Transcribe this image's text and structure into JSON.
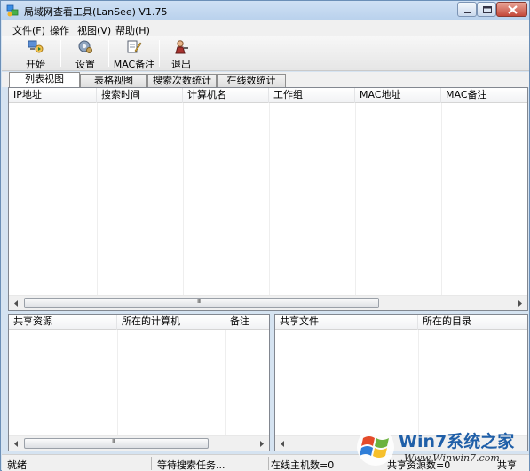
{
  "window": {
    "title": "局域网查看工具(LanSee) V1.75"
  },
  "menu": [
    {
      "label": "文件(F)"
    },
    {
      "label": "操作"
    },
    {
      "label": "视图(V)"
    },
    {
      "label": "帮助(H)"
    }
  ],
  "toolbar": {
    "start_label": "开始",
    "settings_label": "设置",
    "mac_note_label": "MAC备注",
    "exit_label": "退出"
  },
  "tabs": [
    {
      "label": "列表视图",
      "active": true
    },
    {
      "label": "表格视图",
      "active": false
    },
    {
      "label": "搜索次数统计",
      "active": false
    },
    {
      "label": "在线数统计",
      "active": false
    }
  ],
  "main_table": {
    "columns": [
      "IP地址",
      "搜索时间",
      "计算机名",
      "工作组",
      "MAC地址",
      "MAC备注"
    ],
    "rows": []
  },
  "share_table": {
    "columns": [
      "共享资源",
      "所在的计算机",
      "备注"
    ],
    "rows": []
  },
  "file_table": {
    "columns": [
      "共享文件",
      "所在的目录"
    ],
    "rows": []
  },
  "scroll_grip": "III",
  "status": {
    "ready": "就绪",
    "task": "等待搜索任务...",
    "online_hosts": "在线主机数=0",
    "shares": "共享资源数=0",
    "share_short": "共享"
  },
  "watermark": {
    "brand": "Win7系统之家",
    "url": "Www.Winwin7.com"
  },
  "colors": {
    "window_frame": "#d5e3f1",
    "titlebar": "#b9d1ec",
    "close_button": "#c4483a",
    "watermark_text": "#1f5fa8"
  }
}
